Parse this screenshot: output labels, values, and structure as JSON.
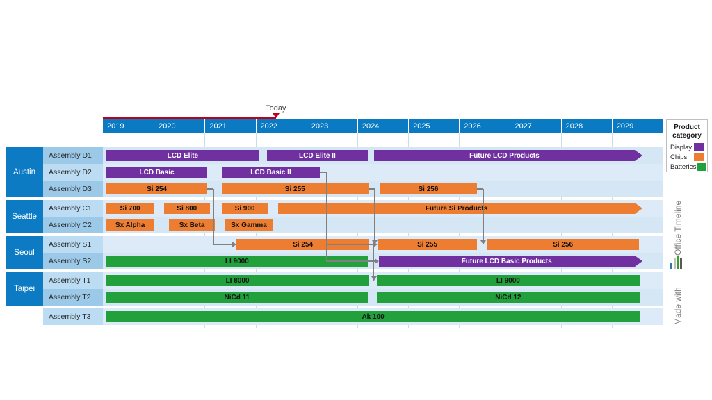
{
  "timeline": {
    "today_label": "Today",
    "today_color": "#C00018",
    "years": [
      "2019",
      "2020",
      "2021",
      "2022",
      "2023",
      "2024",
      "2025",
      "2026",
      "2027",
      "2028",
      "2029"
    ],
    "start_year": 2019,
    "end_year": 2030,
    "header_color": "#0A7AC2"
  },
  "legend": {
    "title_line1": "Product",
    "title_line2": "category",
    "items": [
      {
        "label": "Display",
        "color": "#7030A0"
      },
      {
        "label": "Chips",
        "color": "#ED7D31"
      },
      {
        "label": "Batteries",
        "color": "#22A03C"
      }
    ]
  },
  "branding": {
    "product": "Office Timeline",
    "made_with": "Made with"
  },
  "groups": [
    {
      "name": "Austin",
      "rows": [
        {
          "label": "Assembly D1",
          "bars": [
            {
              "text": "LCD Elite",
              "category": "display",
              "start": 2019.07,
              "end": 2022.07,
              "arrow": false
            },
            {
              "text": "LCD Elite II",
              "category": "display",
              "start": 2022.23,
              "end": 2024.2,
              "arrow": false
            },
            {
              "text": "Future LCD Products",
              "category": "display",
              "start": 2024.33,
              "end": 2029.6,
              "arrow": true
            }
          ]
        },
        {
          "label": "Assembly D2",
          "bars": [
            {
              "text": "LCD Basic",
              "category": "display",
              "start": 2019.07,
              "end": 2021.05,
              "arrow": false
            },
            {
              "text": "LCD Basic II",
              "category": "display",
              "start": 2021.33,
              "end": 2023.27,
              "arrow": false
            }
          ]
        },
        {
          "label": "Assembly D3",
          "bars": [
            {
              "text": "Si 254",
              "category": "chips",
              "start": 2019.07,
              "end": 2021.05,
              "arrow": false
            },
            {
              "text": "Si 255",
              "category": "chips",
              "start": 2021.33,
              "end": 2024.22,
              "arrow": false
            },
            {
              "text": "Si 256",
              "category": "chips",
              "start": 2024.44,
              "end": 2026.35,
              "arrow": false
            }
          ]
        }
      ]
    },
    {
      "name": "Seattle",
      "rows": [
        {
          "label": "Assembly C1",
          "bars": [
            {
              "text": "Si 700",
              "category": "chips",
              "start": 2019.07,
              "end": 2020.0,
              "arrow": false
            },
            {
              "text": "Si 800",
              "category": "chips",
              "start": 2020.2,
              "end": 2021.1,
              "arrow": false
            },
            {
              "text": "Si 900",
              "category": "chips",
              "start": 2021.33,
              "end": 2022.25,
              "arrow": false
            },
            {
              "text": "Future Si Products",
              "category": "chips",
              "start": 2022.45,
              "end": 2029.6,
              "arrow": true
            }
          ]
        },
        {
          "label": "Assembly C2",
          "bars": [
            {
              "text": "Sx Alpha",
              "category": "chips",
              "start": 2019.07,
              "end": 2020.0,
              "arrow": false
            },
            {
              "text": "Sx Beta",
              "category": "chips",
              "start": 2020.3,
              "end": 2021.2,
              "arrow": false
            },
            {
              "text": "Sx Gamma",
              "category": "chips",
              "start": 2021.4,
              "end": 2022.34,
              "arrow": false
            }
          ]
        }
      ]
    },
    {
      "name": "Seoul",
      "rows": [
        {
          "label": "Assembly S1",
          "bars": [
            {
              "text": "Si 254",
              "category": "chips",
              "start": 2021.62,
              "end": 2024.24,
              "arrow": false
            },
            {
              "text": "Si 255",
              "category": "chips",
              "start": 2024.4,
              "end": 2026.35,
              "arrow": false
            },
            {
              "text": "Si 256",
              "category": "chips",
              "start": 2026.55,
              "end": 2029.53,
              "arrow": false
            }
          ]
        },
        {
          "label": "Assembly S2",
          "bars": [
            {
              "text": "LI 9000",
              "category": "batteries",
              "start": 2019.07,
              "end": 2024.2,
              "arrow": false
            },
            {
              "text": "Future LCD Basic Products",
              "category": "display",
              "start": 2024.42,
              "end": 2029.6,
              "arrow": true
            }
          ]
        }
      ]
    },
    {
      "name": "Taipei",
      "rows": [
        {
          "label": "Assembly T1",
          "bars": [
            {
              "text": "LI 8000",
              "category": "batteries",
              "start": 2019.07,
              "end": 2024.22,
              "arrow": false
            },
            {
              "text": "LI 9000",
              "category": "batteries",
              "start": 2024.38,
              "end": 2029.55,
              "arrow": false
            }
          ]
        },
        {
          "label": "Assembly T2",
          "bars": [
            {
              "text": "NiCd 11",
              "category": "batteries",
              "start": 2019.07,
              "end": 2024.2,
              "arrow": false
            },
            {
              "text": "NiCd 12",
              "category": "batteries",
              "start": 2024.38,
              "end": 2029.55,
              "arrow": false
            }
          ]
        }
      ]
    },
    {
      "name": "",
      "rows": [
        {
          "label": "Assembly T3",
          "bars": [
            {
              "text": "Ak 100",
              "category": "batteries",
              "start": 2019.07,
              "end": 2029.55,
              "arrow": false
            }
          ]
        }
      ]
    }
  ],
  "connectors": [
    {
      "from_row": 2,
      "from_x": 2021.05,
      "to_row": 5,
      "to_x": 2021.62
    },
    {
      "from_row": 1,
      "from_x": 2023.27,
      "to_row": 5,
      "to_x": 2024.4
    },
    {
      "from_row": 2,
      "from_x": 2024.22,
      "to_row": 5,
      "to_x": 2024.4
    },
    {
      "from_row": 2,
      "from_x": 2026.35,
      "to_row": 5,
      "to_x": 2026.55
    },
    {
      "from_row": 1,
      "from_x": 2023.27,
      "to_row": 6,
      "to_x": 2024.42
    },
    {
      "from_row": 5,
      "from_x": 2024.2,
      "to_row": 7,
      "to_x": 2024.38
    }
  ]
}
